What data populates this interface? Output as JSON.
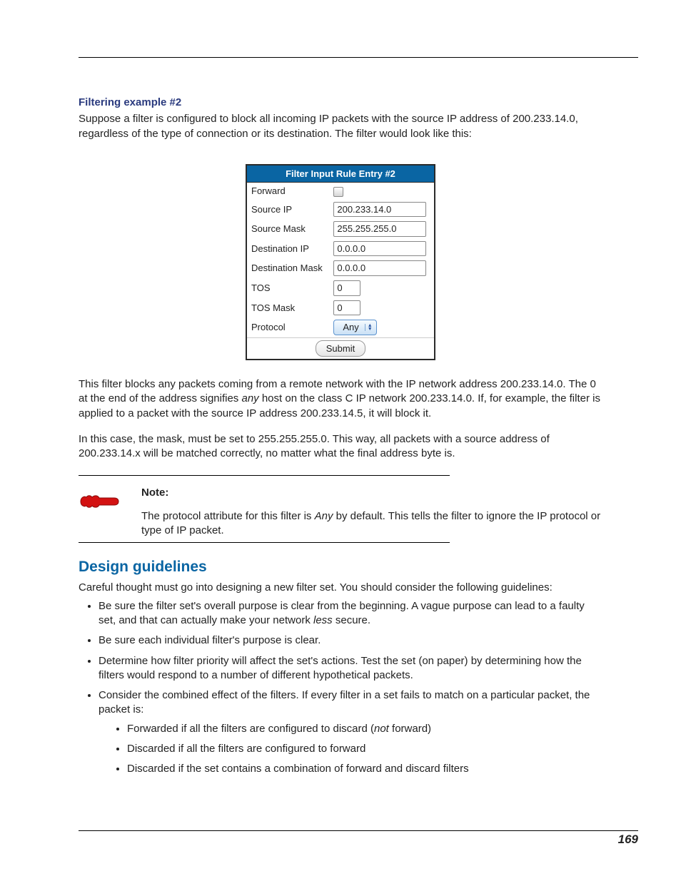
{
  "heading_example": "Filtering example #2",
  "intro": "Suppose a filter is configured to block all incoming IP packets with the source IP address of 200.233.14.0, regardless of the type of connection or its destination. The filter would look like this:",
  "figure": {
    "title": "Filter Input Rule Entry #2",
    "rows": {
      "forward_label": "Forward",
      "forward_checked": false,
      "source_ip_label": "Source IP",
      "source_ip_value": "200.233.14.0",
      "source_mask_label": "Source Mask",
      "source_mask_value": "255.255.255.0",
      "dest_ip_label": "Destination IP",
      "dest_ip_value": "0.0.0.0",
      "dest_mask_label": "Destination Mask",
      "dest_mask_value": "0.0.0.0",
      "tos_label": "TOS",
      "tos_value": "0",
      "tos_mask_label": "TOS Mask",
      "tos_mask_value": "0",
      "protocol_label": "Protocol",
      "protocol_value": "Any",
      "submit_label": "Submit"
    }
  },
  "para_after_fig_1a": "This filter blocks any packets coming from a remote network with the IP network address 200.233.14.0. The 0 at the end of the address signifies ",
  "para_after_fig_1_em": "any",
  "para_after_fig_1b": " host on the class C IP network 200.233.14.0. If, for example, the filter is applied to a packet with the source IP address 200.233.14.5, it will block it.",
  "para_after_fig_2": "In this case, the mask, must be set to 255.255.255.0. This way, all packets with a source address of 200.233.14.x will be matched correctly, no matter what the final address byte is.",
  "note": {
    "label": "Note:",
    "text_a": "The protocol attribute for this filter is ",
    "text_em": "Any",
    "text_b": " by default. This tells the filter to ignore the IP protocol or type of IP packet."
  },
  "section_head": "Design guidelines",
  "section_intro": "Careful thought must go into designing a new filter set. You should consider the following guidelines:",
  "bullets": [
    {
      "pre": "Be sure the filter set's overall purpose is clear from the beginning. A vague purpose can lead to a faulty set, and that can actually make your network ",
      "em": "less",
      "post": " secure."
    },
    {
      "plain": "Be sure each individual filter's purpose is clear."
    },
    {
      "plain": "Determine how filter priority will affect the set's actions. Test the set (on paper) by determining how the filters would respond to a number of different hypothetical packets."
    },
    {
      "plain": "Consider the combined effect of the filters. If every filter in a set fails to match on a particular packet, the packet is:",
      "sub": [
        {
          "pre": "Forwarded if all the filters are configured to discard (",
          "em": "not",
          "post": " forward)"
        },
        {
          "plain": "Discarded if all the filters are configured to forward"
        },
        {
          "plain": "Discarded if the set contains a combination of forward and discard filters"
        }
      ]
    }
  ],
  "page_number": "169"
}
